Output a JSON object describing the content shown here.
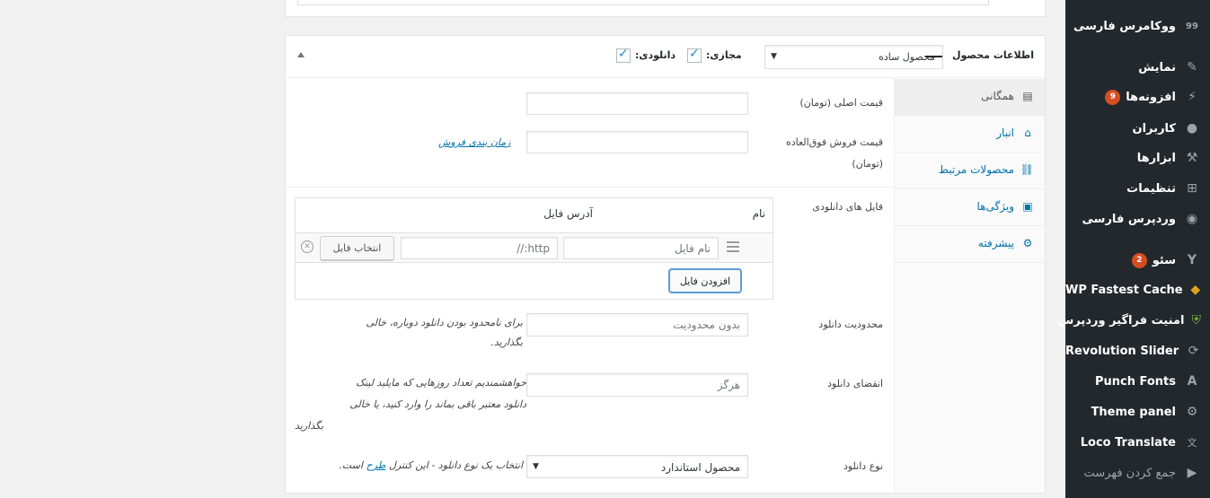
{
  "sidebar": {
    "items": [
      {
        "label": "ووکامرس فارسی",
        "icon": "woo-icon",
        "badge": ""
      },
      {
        "label": "نمایش",
        "icon": "appearance-icon",
        "badge": ""
      },
      {
        "label": "افزونه‌ها",
        "icon": "plugins-icon",
        "badge": "9"
      },
      {
        "label": "کاربران",
        "icon": "users-icon",
        "badge": ""
      },
      {
        "label": "ابزارها",
        "icon": "tools-icon",
        "badge": ""
      },
      {
        "label": "تنظیمات",
        "icon": "settings-icon",
        "badge": ""
      },
      {
        "label": "وردپرس فارسی",
        "icon": "wp-persian-icon",
        "badge": ""
      },
      {
        "label": "سئو",
        "icon": "yoast-icon",
        "badge": "2"
      },
      {
        "label": "WP Fastest Cache",
        "icon": "cheetah-icon",
        "badge": ""
      },
      {
        "label": "امنیت فراگیر وردپرس",
        "icon": "shield-icon",
        "badge": ""
      },
      {
        "label": "Revolution Slider",
        "icon": "refresh-icon",
        "badge": ""
      },
      {
        "label": "Punch Fonts",
        "icon": "font-icon",
        "badge": ""
      },
      {
        "label": "Theme panel",
        "icon": "gear-icon",
        "badge": ""
      },
      {
        "label": "Loco Translate",
        "icon": "translate-icon",
        "badge": ""
      }
    ],
    "collapse_label": "جمع کردن فهرست"
  },
  "product_data": {
    "title": "اطلاعات محصول",
    "type_select": "محصول ساده",
    "virtual_label": "مجازی:",
    "downloadable_label": "دانلودی:",
    "virtual_checked": true,
    "downloadable_checked": true
  },
  "tabs": [
    {
      "label": "همگانی",
      "icon": "general-icon",
      "glyph": "▤"
    },
    {
      "label": "انبار",
      "icon": "inventory-icon",
      "glyph": "⌂"
    },
    {
      "label": "محصولات مرتبط",
      "icon": "linked-products-icon",
      "glyph": "⛓"
    },
    {
      "label": "ویژگی‌ها",
      "icon": "attributes-icon",
      "glyph": "▣"
    },
    {
      "label": "پیشرفته",
      "icon": "advanced-icon",
      "glyph": "⚙"
    }
  ],
  "general": {
    "regular_price_label": "قیمت اصلی (تومان)",
    "sale_price_label_1": "قیمت فروش فوق‌العاده",
    "sale_price_label_2": "(تومان)",
    "schedule_link": "زمان بندی فروش",
    "files_label": "فایل های دانلودی",
    "col_name": "نام",
    "col_url": "آدرس فایل",
    "file_name_placeholder": "نام فایل",
    "file_url_placeholder": "http://",
    "choose_file_button": "انتخاب فایل",
    "add_file_button": "افزودن فایل",
    "limit_label": "محدودیت دانلود",
    "limit_placeholder": "بدون محدودیت",
    "limit_desc_1": "برای نامحدود بودن دانلود دوباره، خالی",
    "limit_desc_2": "بگذارید.",
    "expiry_label": "انقضای دانلود",
    "expiry_placeholder": "هرگز",
    "expiry_desc_1": "خواهشمندیم تعداد روزهایی که مایلید لینک",
    "expiry_desc_2": "دانلود معتبر باقی بماند را وارد کنید، یا خالی",
    "expiry_desc_3": "بگذارید",
    "type_label": "نوع دانلود",
    "type_select": "محصول استاندارد",
    "type_desc_pre": "انتخاب یک نوع دانلود - این کنترل",
    "type_desc_link": "طرح",
    "type_desc_post": "است."
  }
}
